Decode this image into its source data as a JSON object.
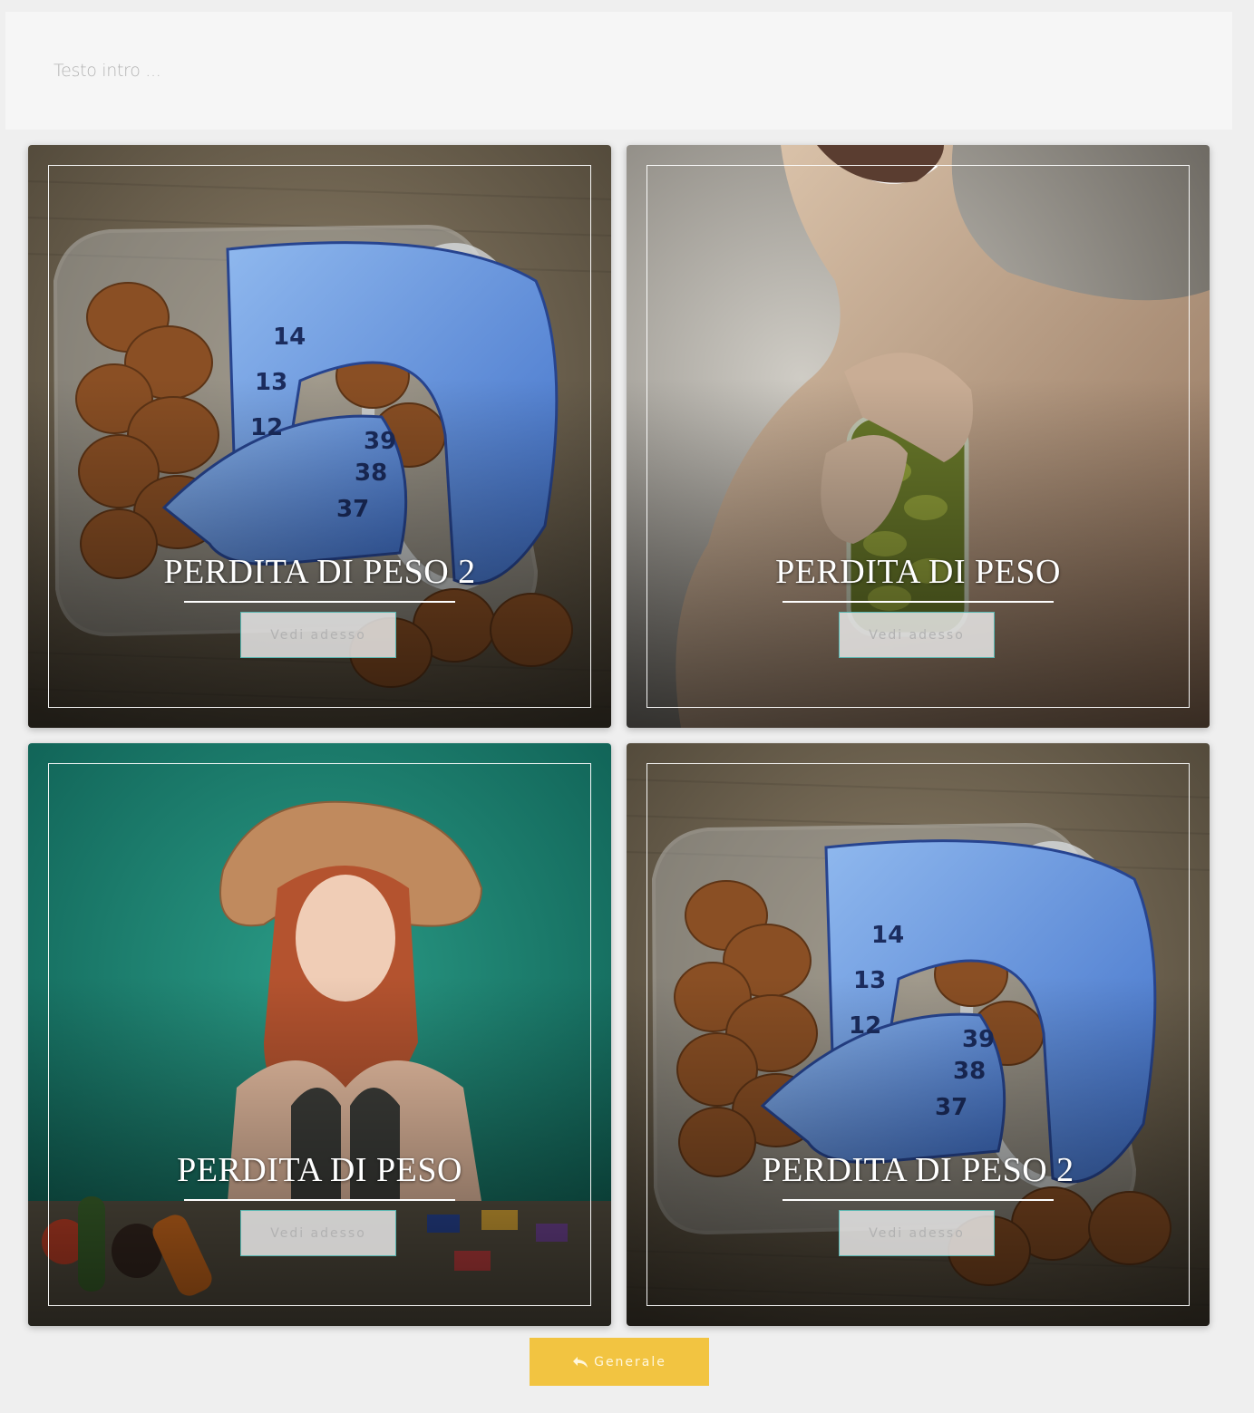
{
  "intro": {
    "placeholder": "Testo intro ..."
  },
  "cards": [
    {
      "title": "PERDITA DI PESO 2",
      "button": "Vedi adesso",
      "image": "hazelnuts-jar-measuring-tape"
    },
    {
      "title": "PERDITA DI PESO",
      "button": "Vedi adesso",
      "image": "man-opening-pickle-jar"
    },
    {
      "title": "PERDITA DI PESO",
      "button": "Vedi adesso",
      "image": "woman-straw-hat-vegetables-candies"
    },
    {
      "title": "PERDITA DI PESO 2",
      "button": "Vedi adesso",
      "image": "hazelnuts-jar-measuring-tape"
    }
  ],
  "footer": {
    "button": "Generale",
    "button_icon": "reply-all-icon"
  },
  "colors": {
    "page_bg": "#efefef",
    "intro_bg": "#f6f6f6",
    "button_border": "#58b7b1",
    "general_button": "#f2c441"
  }
}
